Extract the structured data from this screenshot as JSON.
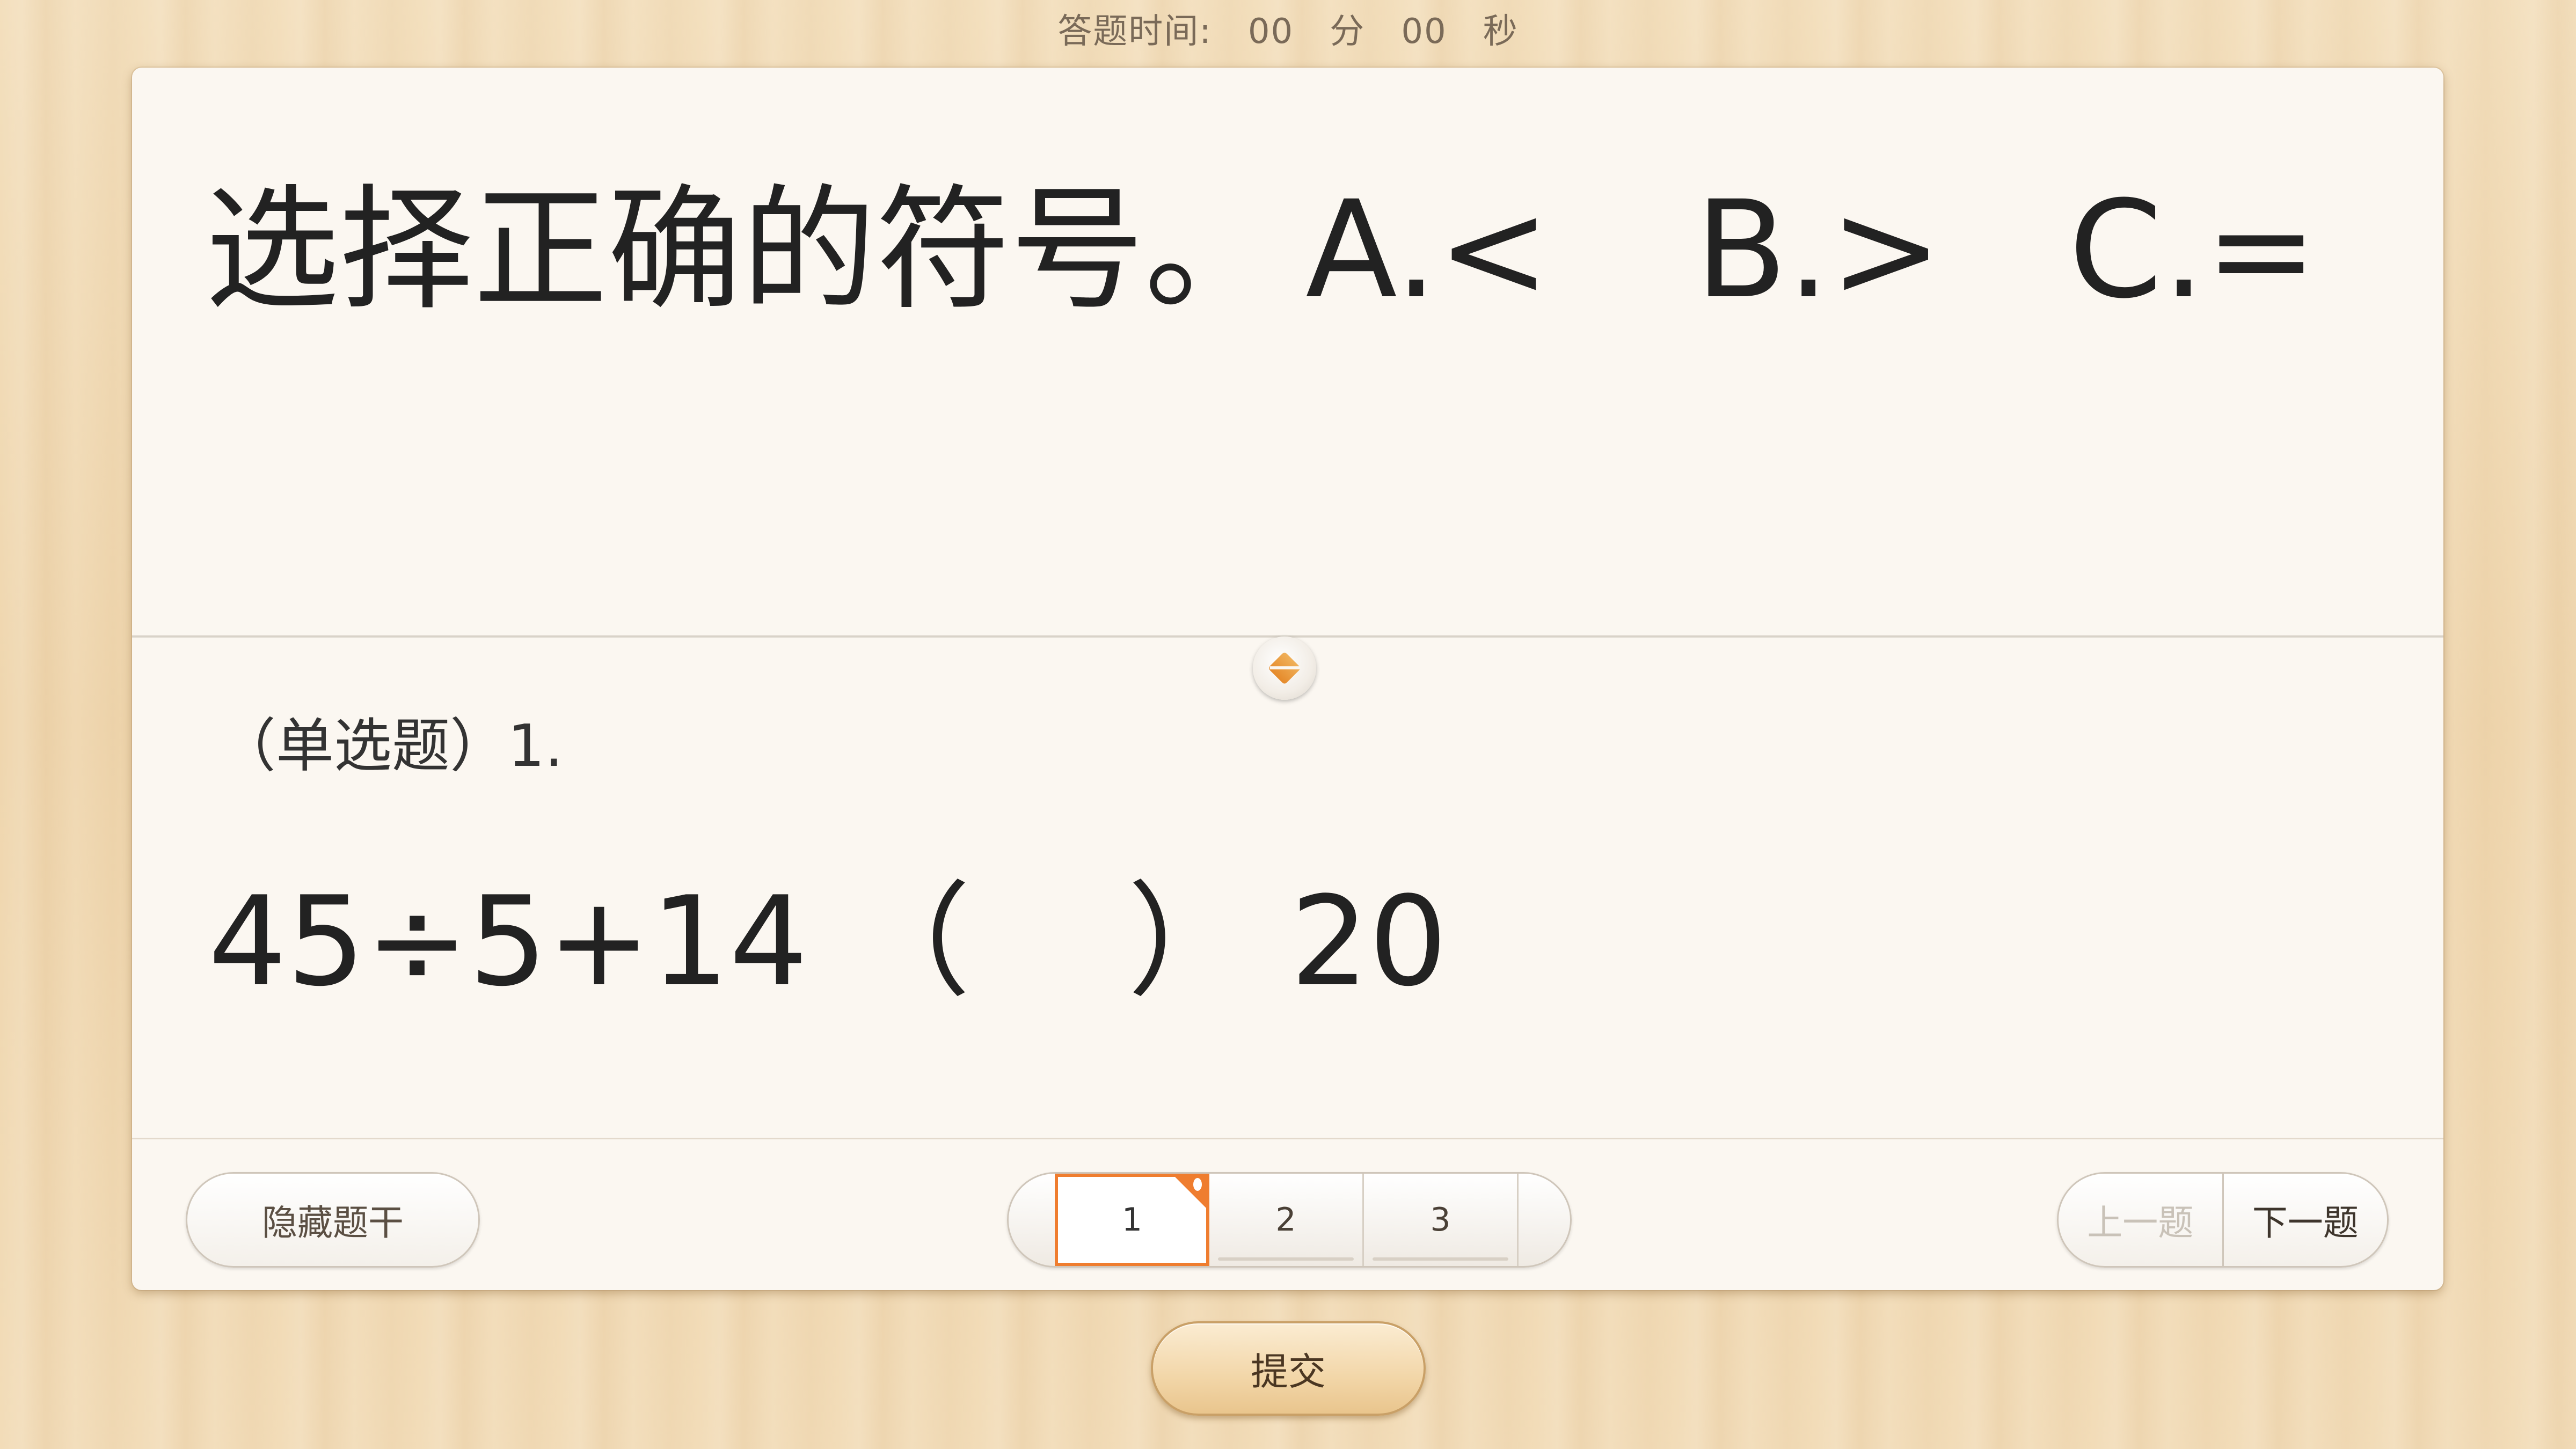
{
  "timer": {
    "label": "答题时间:",
    "minutes": "00",
    "minutes_unit": "分",
    "seconds": "00",
    "seconds_unit": "秒"
  },
  "question": {
    "stem": "选择正确的符号。",
    "options": [
      {
        "letter": "A.",
        "symbol": "<"
      },
      {
        "letter": "B.",
        "symbol": ">"
      },
      {
        "letter": "C.",
        "symbol": "="
      }
    ],
    "type_label": "（单选题）1.",
    "expression": "45÷5+14 （    ） 20"
  },
  "footer": {
    "hide_stem_label": "隐藏题干",
    "pages": [
      "1",
      "2",
      "3"
    ],
    "current_page": "1",
    "prev_label": "上一题",
    "next_label": "下一题"
  },
  "submit_label": "提交",
  "colors": {
    "accent_orange": "#ef7d2f",
    "card_background": "#fbf7f1",
    "wood_background": "#f0d9b5"
  },
  "icons": {
    "splitter": "diamond-drag-icon",
    "current_page_marker": "corner-flag-icon"
  }
}
